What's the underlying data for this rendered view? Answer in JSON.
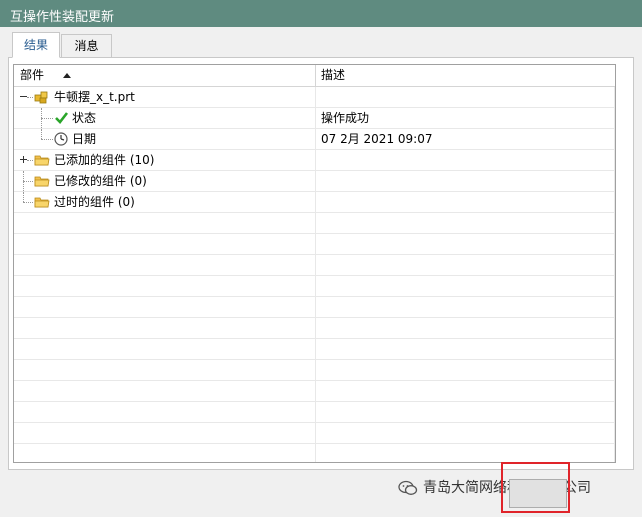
{
  "window": {
    "title": "互操作性装配更新"
  },
  "tabs": [
    {
      "label": "结果",
      "active": true
    },
    {
      "label": "消息",
      "active": false
    }
  ],
  "table": {
    "columns": [
      {
        "label": "部件",
        "sort": "ascending"
      },
      {
        "label": "描述"
      }
    ],
    "rows": [
      {
        "name": "牛顿摆_x_t.prt",
        "desc": "",
        "icon": "assembly-icon",
        "expander": "collapse"
      },
      {
        "name": "状态",
        "desc": "操作成功",
        "icon": "checkmark-icon"
      },
      {
        "name": "日期",
        "desc": "07 2月 2021 09:07",
        "icon": "clock-icon"
      },
      {
        "name": "已添加的组件 (10)",
        "desc": "",
        "icon": "folder-icon",
        "expander": "expand"
      },
      {
        "name": "已修改的组件 (0)",
        "desc": "",
        "icon": "folder-icon"
      },
      {
        "name": "过时的组件 (0)",
        "desc": "",
        "icon": "folder-icon"
      }
    ]
  },
  "watermark": {
    "text": "青岛大简网络科技有限公司",
    "icon": "wechat-icon"
  },
  "colors": {
    "titlebar": "#5f8b80",
    "highlight": "#e0242a",
    "check": "#2aa52a"
  }
}
